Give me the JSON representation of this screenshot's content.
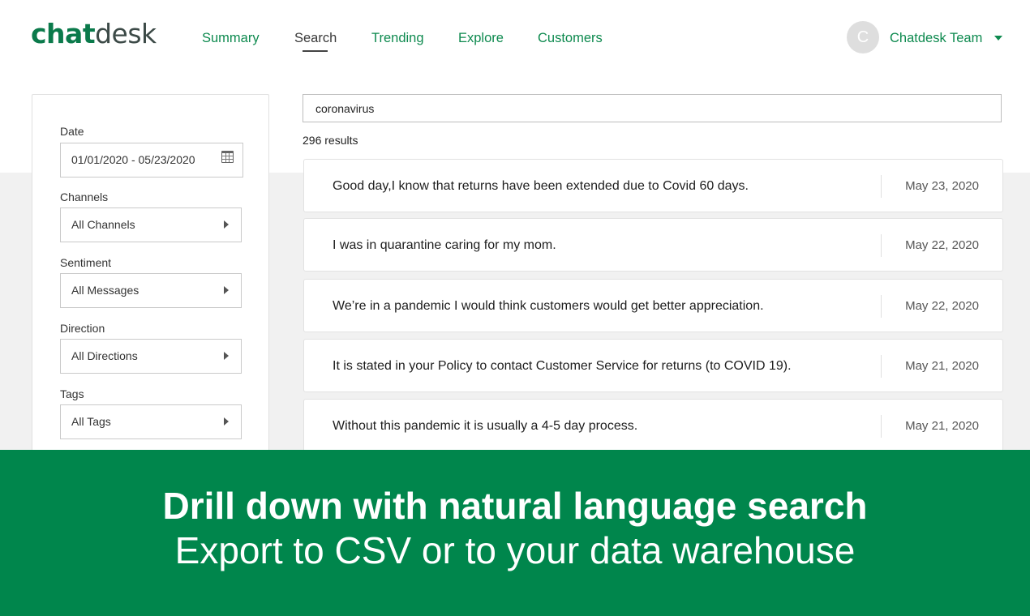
{
  "header": {
    "logo_bold": "chat",
    "logo_light": "desk",
    "nav": [
      "Summary",
      "Search",
      "Trending",
      "Explore",
      "Customers"
    ],
    "active_nav": "Search",
    "avatar_letter": "C",
    "team_name": "Chatdesk Team",
    "team_menu_icon": "caret-down-icon"
  },
  "filters": {
    "date": {
      "label": "Date",
      "value": "01/01/2020 - 05/23/2020",
      "icon": "calendar-icon"
    },
    "channels": {
      "label": "Channels",
      "value": "All Channels"
    },
    "sentiment": {
      "label": "Sentiment",
      "value": "All Messages"
    },
    "direction": {
      "label": "Direction",
      "value": "All Directions"
    },
    "tags": {
      "label": "Tags",
      "value": "All Tags"
    }
  },
  "search": {
    "query": "coronavirus",
    "results_count": "296 results"
  },
  "results": [
    {
      "text": "Good day,I know that returns have been extended due to Covid 60 days.",
      "date": "May 23, 2020"
    },
    {
      "text": "I was in quarantine caring for my mom.",
      "date": "May 22, 2020"
    },
    {
      "text": "We’re in a pandemic I would think customers would get better appreciation.",
      "date": "May 22, 2020"
    },
    {
      "text": "It is stated in your Policy to contact Customer Service for returns (to COVID 19).",
      "date": "May 21, 2020"
    },
    {
      "text": "Without this pandemic it is usually a 4-5 day process.",
      "date": "May 21, 2020"
    }
  ],
  "banner": {
    "title": "Drill down with natural language search",
    "subtitle": "Export to CSV or to your data warehouse"
  },
  "colors": {
    "brand_green": "#0b7a4b",
    "nav_green": "#0e8a4f",
    "banner_green": "#00864c"
  }
}
